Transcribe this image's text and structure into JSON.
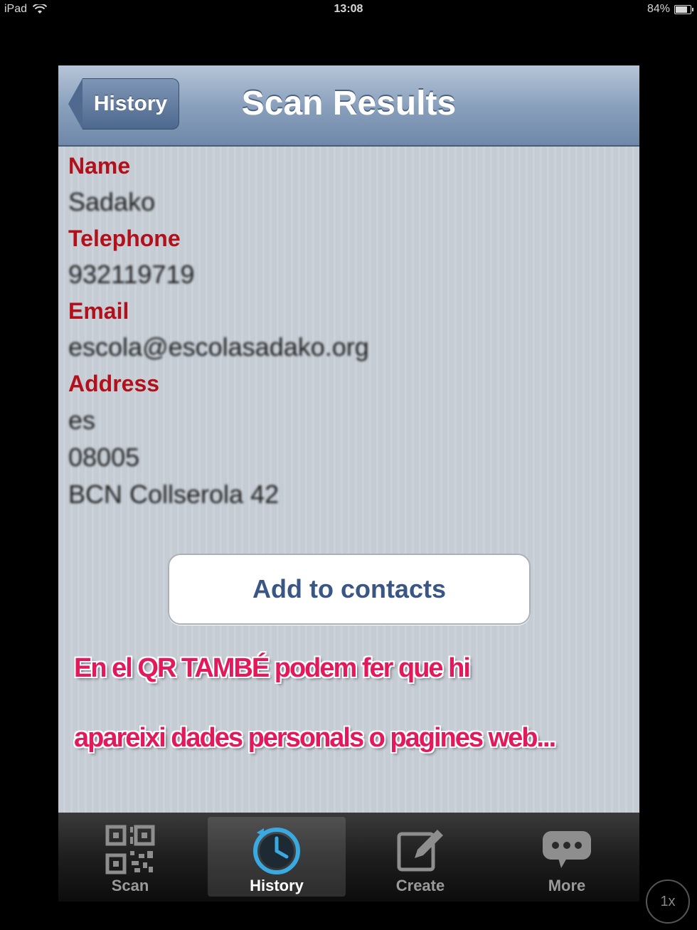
{
  "status_bar": {
    "device": "iPad",
    "time": "13:08",
    "battery": "84%",
    "battery_level": 0.84
  },
  "navbar": {
    "back_label": "History",
    "title": "Scan Results"
  },
  "contact": {
    "name_label": "Name",
    "name_value": "Sadako",
    "telephone_label": "Telephone",
    "telephone_value": "932119719",
    "email_label": "Email",
    "email_value": "escola@escolasadako.org",
    "address_label": "Address",
    "address_lines": [
      "es",
      "08005",
      "BCN Collserola 42"
    ]
  },
  "add_button_label": "Add to contacts",
  "caption": {
    "line1": "En el QR TAMBÉ podem fer que hi",
    "line2": "apareixi dades personals o pagines web..."
  },
  "tabs": [
    {
      "label": "Scan",
      "icon": "qr-code-icon"
    },
    {
      "label": "History",
      "icon": "clock-icon"
    },
    {
      "label": "Create",
      "icon": "compose-icon"
    },
    {
      "label": "More",
      "icon": "speech-bubble-icon"
    }
  ],
  "active_tab": "History",
  "zoom_label": "1x",
  "colors": {
    "field_label": "#b2101a",
    "caption": "#e2195a",
    "button_text": "#3a5684",
    "history_icon": "#39a9e0"
  }
}
